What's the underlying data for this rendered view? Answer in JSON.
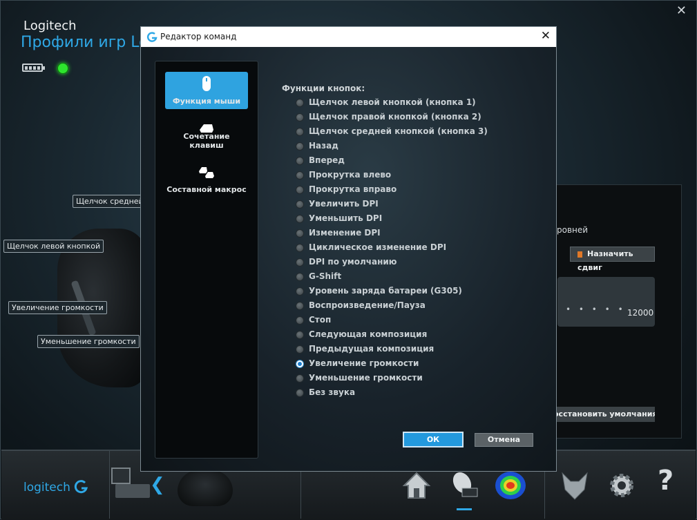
{
  "app": {
    "brand": "Logitech",
    "profiles_title": "Профили игр Lo",
    "close_glyph": "✕",
    "status_color": "#2ee52e"
  },
  "callouts": {
    "middle_click": "Щелчок средней кн",
    "left_click": "Щелчок левой кнопкой",
    "volume_up": "Увеличение громкости",
    "volume_down": "Уменьшение громкости"
  },
  "right_panel": {
    "levels_text": "ровней",
    "assign_shift_button": "Назначить сдвиг",
    "slider_value": "12000",
    "restore_defaults_button": "осстановить умолчания"
  },
  "bottom_bar": {
    "logo_text": "logitech",
    "back_glyph": "❮",
    "help_glyph": "?"
  },
  "dialog": {
    "title": "Редактор команд",
    "close_glyph": "✕",
    "menu": [
      {
        "label": "Функция мыши",
        "active": true,
        "icon": "mouse-icon"
      },
      {
        "label": "Сочетание клавиш",
        "active": false,
        "icon": "key-icon"
      },
      {
        "label": "Составной макрос",
        "active": false,
        "icon": "keys-icon"
      }
    ],
    "functions_title": "Функции кнопок:",
    "options": [
      "Щелчок левой кнопкой (кнопка 1)",
      "Щелчок правой кнопкой (кнопка 2)",
      "Щелчок средней кнопкой (кнопка 3)",
      "Назад",
      "Вперед",
      "Прокрутка влево",
      "Прокрутка вправо",
      "Увеличить DPI",
      "Уменьшить DPI",
      "Изменение DPI",
      "Циклическое изменение DPI",
      "DPI по умолчанию",
      "G-Shift",
      "Уровень заряда батареи (G305)",
      "Воспроизведение/Пауза",
      "Стоп",
      "Следующая композиция",
      "Предыдущая композиция",
      "Увеличение громкости",
      "Уменьшение громкости",
      "Без звука"
    ],
    "selected_option": "Увеличение громкости",
    "ok_button": "ОК",
    "cancel_button": "Отмена",
    "accent_color": "#2fa3e0"
  }
}
